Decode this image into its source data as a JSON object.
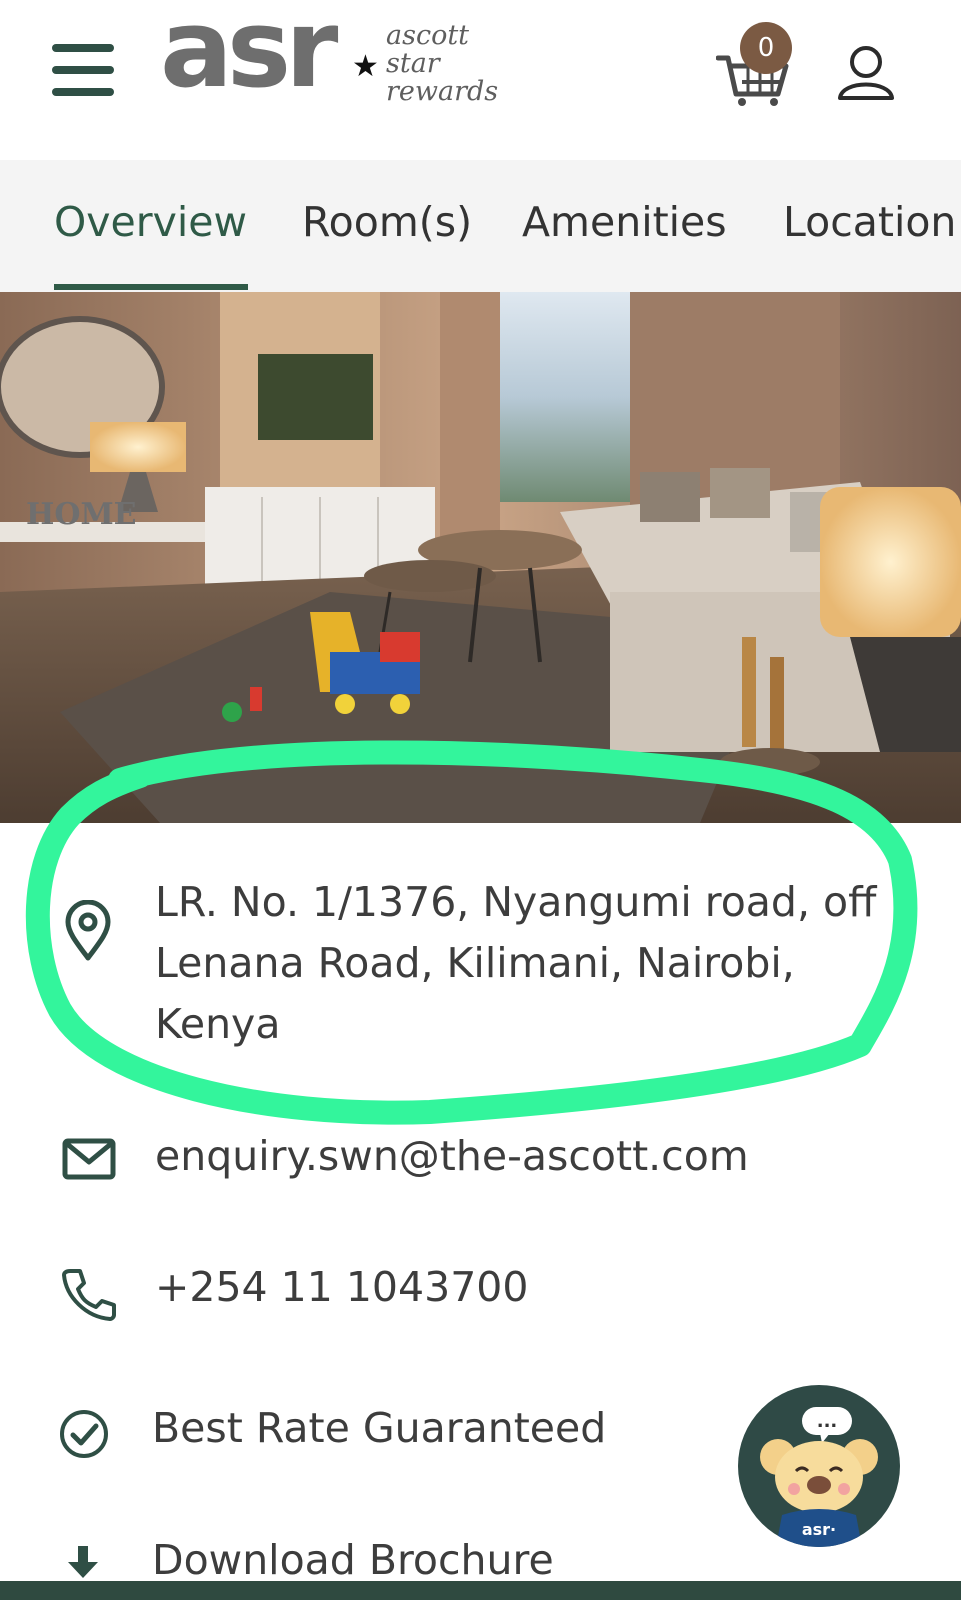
{
  "header": {
    "logo_mark": "asr",
    "logo_lines": [
      "ascott",
      "star",
      "rewards"
    ],
    "cart_count": "0"
  },
  "tabs": [
    {
      "label": "Overview",
      "active": true
    },
    {
      "label": "Room(s)",
      "active": false
    },
    {
      "label": "Amenities",
      "active": false
    },
    {
      "label": "Location",
      "active": false
    }
  ],
  "hero": {
    "wall_sign": "HOME"
  },
  "contact": {
    "address_lines": [
      "LR. No. 1/1376, Nyangumi road, off",
      "Lenana Road, Kilimani, Nairobi,",
      "Kenya"
    ],
    "email": "enquiry.swn@the-ascott.com",
    "phone": "+254 11 1043700"
  },
  "features": {
    "best_rate": "Best Rate Guaranteed",
    "brochure": "Download Brochure"
  },
  "chat": {
    "mascot_label": "asr·",
    "bubble": "..."
  },
  "icons": {
    "menu": "hamburger-menu-icon",
    "cart": "shopping-cart-icon",
    "account": "user-icon",
    "address": "location-pin-icon",
    "email": "envelope-icon",
    "phone": "phone-icon",
    "rate": "check-circle-icon",
    "brochure": "download-arrow-icon"
  },
  "colors": {
    "brand_green": "#2f5a47",
    "icon_green": "#2f4f45",
    "badge_brown": "#7b5a43",
    "highlight_mint": "#33f59c",
    "tab_background": "#f4f4f4"
  }
}
